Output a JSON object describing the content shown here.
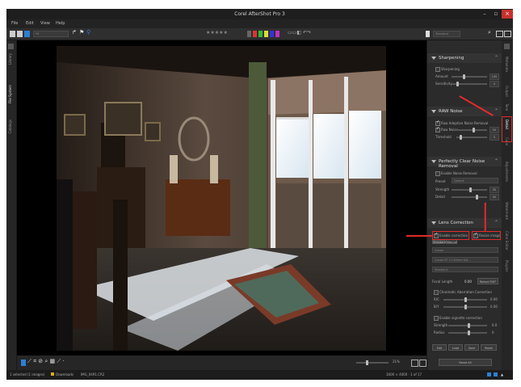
{
  "app": {
    "title": "Corel AfterShot Pro 3"
  },
  "menu": [
    "File",
    "Edit",
    "View",
    "Help"
  ],
  "left_strip": [
    "Library",
    "File System",
    "Catalogs"
  ],
  "right_strip": [
    "Metadata",
    "Output",
    "Tone",
    "Detail",
    "Color",
    "Adjustments",
    "Watermark",
    "Color Editor",
    "Plugins"
  ],
  "toolbar": {
    "zoom_label": "Fit",
    "rating": "★★★★★",
    "preset_label": "Standard"
  },
  "panel": {
    "sharpening": {
      "title": "Sharpening",
      "enable": "Sharpening",
      "amount": "Amount",
      "amount_val": "100",
      "sensitivity": "Sensitivity",
      "sens_val": "0"
    },
    "raw_noise": {
      "title": "RAW Noise",
      "enable1": "Raw Adaptive Noise Removal",
      "enable2": "Raw Noise",
      "val1": "50",
      "threshold": "Threshold",
      "val2": "0"
    },
    "perfectly_clear": {
      "title": "Perfectly Clear Noise Removal",
      "enable": "Enable Noise Removal",
      "preset": "Preset",
      "preset_val": "Default",
      "strength": "Strength",
      "strength_val": "50",
      "detail": "Detail",
      "detail_val": "50"
    },
    "lens": {
      "title": "Lens Correction",
      "enable_correction": "Enable correction",
      "resize_image": "Resize image",
      "tab_standard": "Standard",
      "tab_manual": "Manual",
      "camera": "Canon",
      "lens": "Canon EF 17-40mm f/4L",
      "mode": "Standard",
      "focal_length": "Focal Length",
      "focal_val": "0.00",
      "reload": "Reload EXIF",
      "chromatic": "Chromatic Aberration Correction",
      "rc": "R/C",
      "bc": "B/Y",
      "rc_val": "0.00",
      "bc_val": "0.00",
      "vignetting": "Enable vignette correction",
      "strength": "Strength",
      "radius": "Radius",
      "s_val": "0.0",
      "r_val": "0",
      "btn_edit": "Edit",
      "btn_load": "Load",
      "btn_save": "Save",
      "btn_reset": "Reset",
      "reset_all": "Reset All"
    }
  },
  "bottom": {
    "zoom_pct": "21%"
  },
  "status": {
    "selection": "1 selected (1 images)",
    "folder": "Downloads",
    "file": "IMG_0491.CR2",
    "right": "3000 × 4000 · 1 of 17"
  },
  "colors": {
    "accent": "#2d7fd3",
    "highlight": "#e32b2b"
  }
}
